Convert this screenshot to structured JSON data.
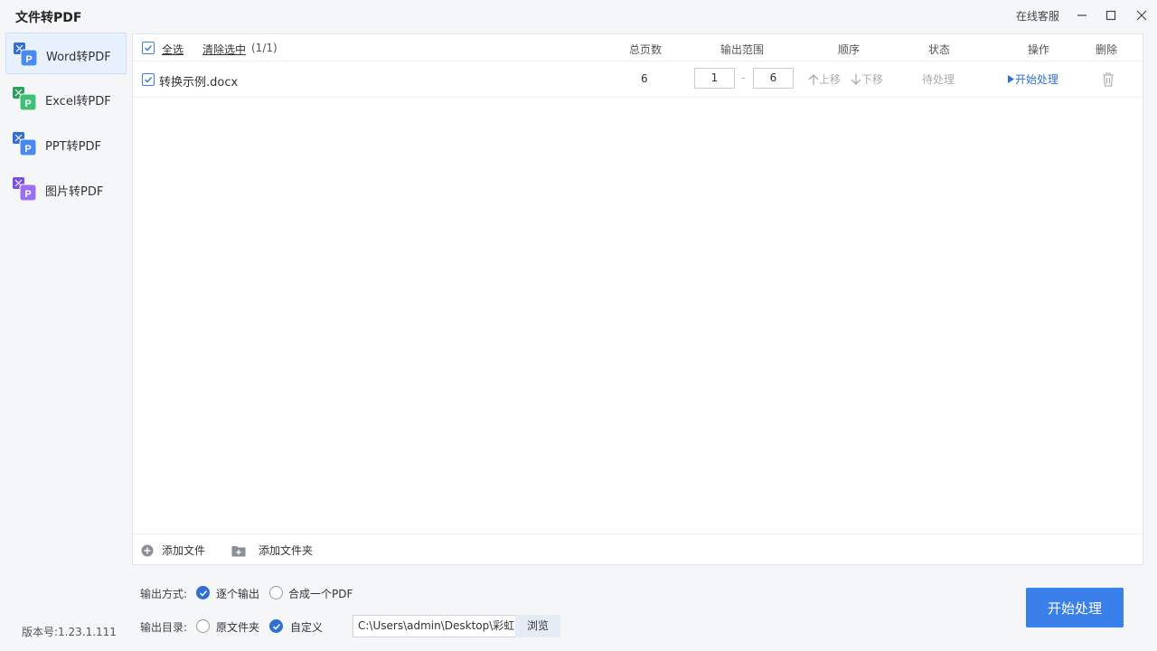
{
  "app": {
    "title": "文件转PDF",
    "support": "在线客服",
    "version": "版本号:1.23.1.111"
  },
  "sidebar": {
    "items": [
      {
        "label": "Word转PDF",
        "icon": "word-to-pdf-icon",
        "color": "#2f6fd6",
        "active": true
      },
      {
        "label": "Excel转PDF",
        "icon": "excel-to-pdf-icon",
        "color": "#2aa15a",
        "active": false
      },
      {
        "label": "PPT转PDF",
        "icon": "ppt-to-pdf-icon",
        "color": "#2f6fd6",
        "active": false
      },
      {
        "label": "图片转PDF",
        "icon": "image-to-pdf-icon",
        "color": "#7b4fe0",
        "active": false
      }
    ]
  },
  "list": {
    "select_all": "全选",
    "clear_selection": "清除选中",
    "count": "(1/1)",
    "columns": {
      "pages": "总页数",
      "range": "输出范围",
      "order": "顺序",
      "status": "状态",
      "action": "操作",
      "delete": "删除"
    },
    "rows": [
      {
        "filename": "转换示例.docx",
        "pages": "6",
        "range_from": "1",
        "range_sep": "-",
        "range_to": "6",
        "move_up": "上移",
        "move_down": "下移",
        "status": "待处理",
        "action": "开始处理"
      }
    ],
    "add_file": "添加文件",
    "add_folder": "添加文件夹"
  },
  "options": {
    "output_mode_label": "输出方式:",
    "mode_each": "逐个输出",
    "mode_merge": "合成一个PDF",
    "output_dir_label": "输出目录:",
    "dir_original": "原文件夹",
    "dir_custom": "自定义",
    "path": "C:\\Users\\admin\\Desktop\\彩虹",
    "browse": "浏览"
  },
  "start_button": "开始处理",
  "colors": {
    "accent": "#3a80ea",
    "active_nav_bg": "#e9f1fe"
  }
}
